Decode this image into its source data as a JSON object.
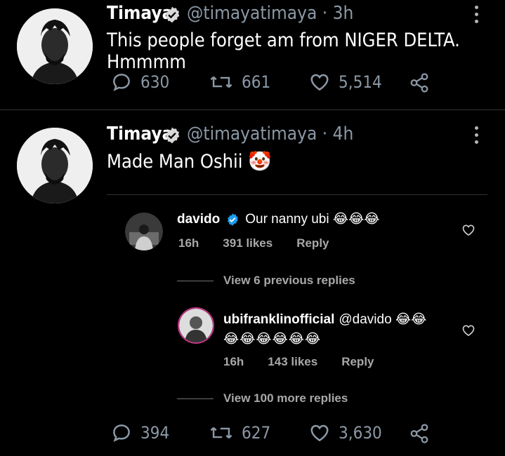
{
  "tweets": [
    {
      "name": "Timaya",
      "handle": "@timayatimaya · 3h",
      "text": "This people forget am from NIGER DELTA. Hmmmm",
      "replies": "630",
      "retweets": "661",
      "likes": "5,514"
    },
    {
      "name": "Timaya",
      "handle": "@timayatimaya · 4h",
      "text": "Made Man Oshii 🤡",
      "replies": "394",
      "retweets": "627",
      "likes": "3,630"
    }
  ],
  "instagram": {
    "comment": {
      "user": "davido",
      "text": "Our nanny ubi 😂😂😂",
      "time": "16h",
      "likes": "391 likes",
      "reply": "Reply"
    },
    "view_previous": "View 6 previous replies",
    "reply": {
      "user": "ubifranklinofficial",
      "text": "@davido 😂😂",
      "text2": "😂😂😂😂😂😂",
      "time": "16h",
      "likes": "143 likes",
      "reply": "Reply"
    },
    "view_more": "View 100 more replies"
  },
  "colors": {
    "background": "#000000",
    "verified": "#1d9bf0",
    "muted": "#8b98a5"
  }
}
